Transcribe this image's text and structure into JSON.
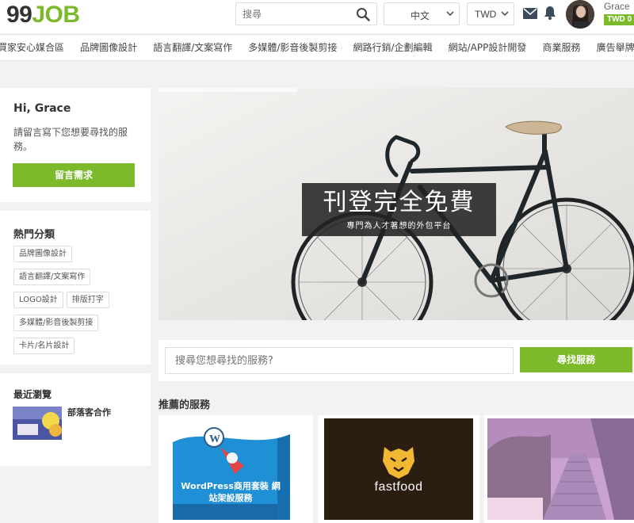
{
  "header": {
    "logo_number": "99",
    "logo_word": "JOB",
    "search_placeholder": "搜尋",
    "language": "中文",
    "currency": "TWD",
    "user_name": "Grace",
    "balance": "TWD 0"
  },
  "nav": {
    "categories": [
      "買家安心媒合區",
      "品牌圖像設計",
      "語言翻譯/文案寫作",
      "多媒體/影音後製剪接",
      "網路行銷/企劃編輯",
      "網站/APP設計開發",
      "商業服務",
      "廣告舉牌"
    ]
  },
  "sidebar": {
    "greeting": "Hi, Grace",
    "prompt": "請留言寫下您想要尋找的服務。",
    "request_button": "留言需求",
    "popular_title": "熱門分類",
    "popular_tags": [
      "品牌圖像設計",
      "語言翻譯/文案寫作",
      "LOGO設計",
      "排版打字",
      "多媒體/影音後製剪接",
      "卡片/名片設計"
    ],
    "recent_title": "最近瀏覽",
    "recent_item": "部落客合作"
  },
  "hero": {
    "headline": "刊登完全免費",
    "subline": "專門為人才著想的外包平台"
  },
  "search": {
    "placeholder": "搜尋您想尋找的服務?",
    "button": "尋找服務"
  },
  "recommended": {
    "title": "推薦的服務",
    "cards": [
      {
        "image_text": "WordPress商用套裝 網站架設服務"
      },
      {
        "image_text": "fastfood"
      },
      {
        "image_text": ""
      }
    ]
  },
  "colors": {
    "brand_green": "#7cba2c",
    "logo_dark": "#333333"
  }
}
